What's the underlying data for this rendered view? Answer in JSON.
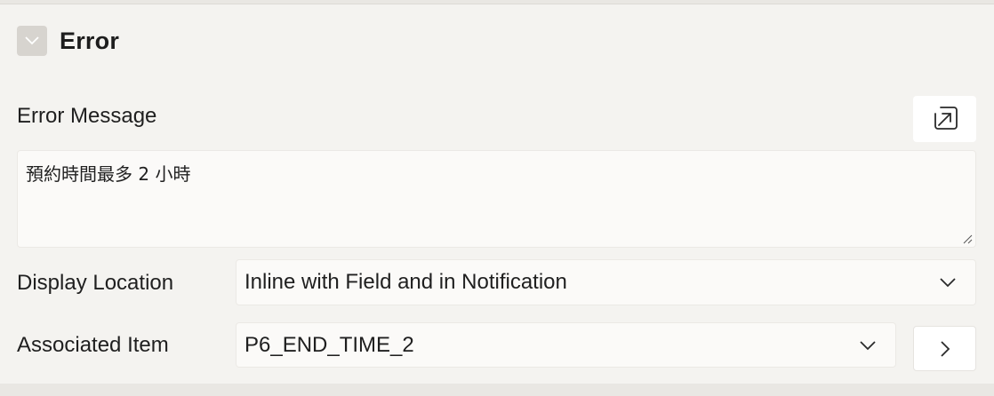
{
  "section": {
    "title": "Error",
    "collapse_icon": "chevron-down-icon"
  },
  "error_message": {
    "label": "Error Message",
    "value": "預約時間最多 2 小時",
    "expand_icon": "expand-arrow-icon"
  },
  "display_location": {
    "label": "Display Location",
    "value": "Inline with Field and in Notification",
    "icon": "chevron-down-icon"
  },
  "associated_item": {
    "label": "Associated Item",
    "value": "P6_END_TIME_2",
    "icon": "chevron-down-icon",
    "nav_icon": "chevron-right-icon"
  }
}
